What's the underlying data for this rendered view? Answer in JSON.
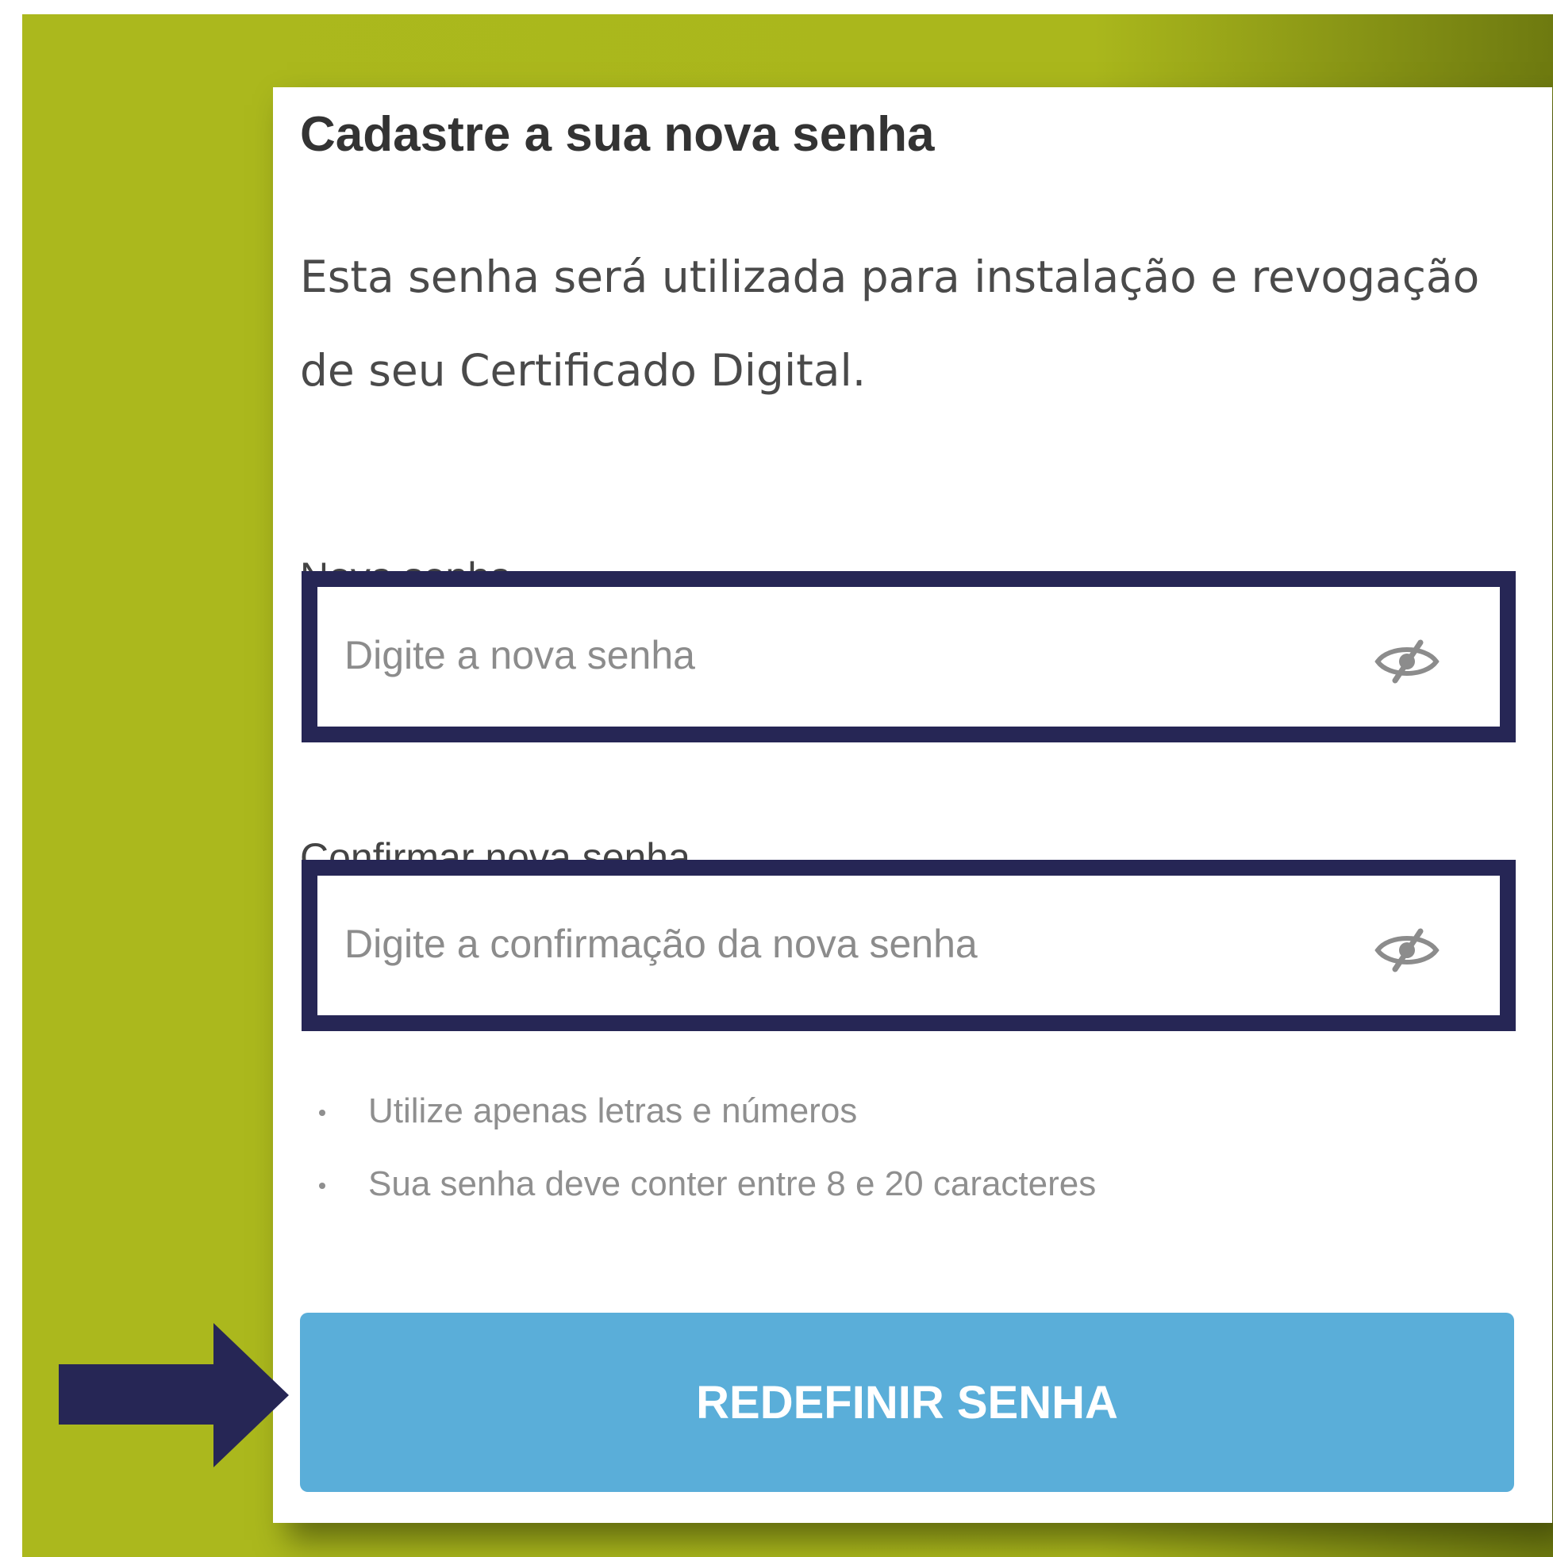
{
  "form": {
    "title": "Cadastre a sua nova senha",
    "description": "Esta senha será utilizada para instalação e revogação de seu Certificado Digital.",
    "new_password": {
      "label": "Nova senha",
      "placeholder": "Digite a nova senha",
      "value": "",
      "toggle_icon": "eye-slash-icon"
    },
    "confirm_password": {
      "label": "Confirmar nova senha",
      "placeholder": "Digite a confirmação da nova senha",
      "value": "",
      "toggle_icon": "eye-slash-icon"
    },
    "rules": [
      "Utilize apenas letras e números",
      "Sua senha deve conter entre 8 e 20 caracteres"
    ],
    "submit_label": "REDEFINIR SENHA"
  },
  "annotation": {
    "arrow_icon": "arrow-right-icon",
    "arrow_color": "#262655"
  },
  "colors": {
    "background": "#abb81d",
    "field_border": "#262655",
    "button": "#5aaed9",
    "button_text": "#ffffff"
  }
}
